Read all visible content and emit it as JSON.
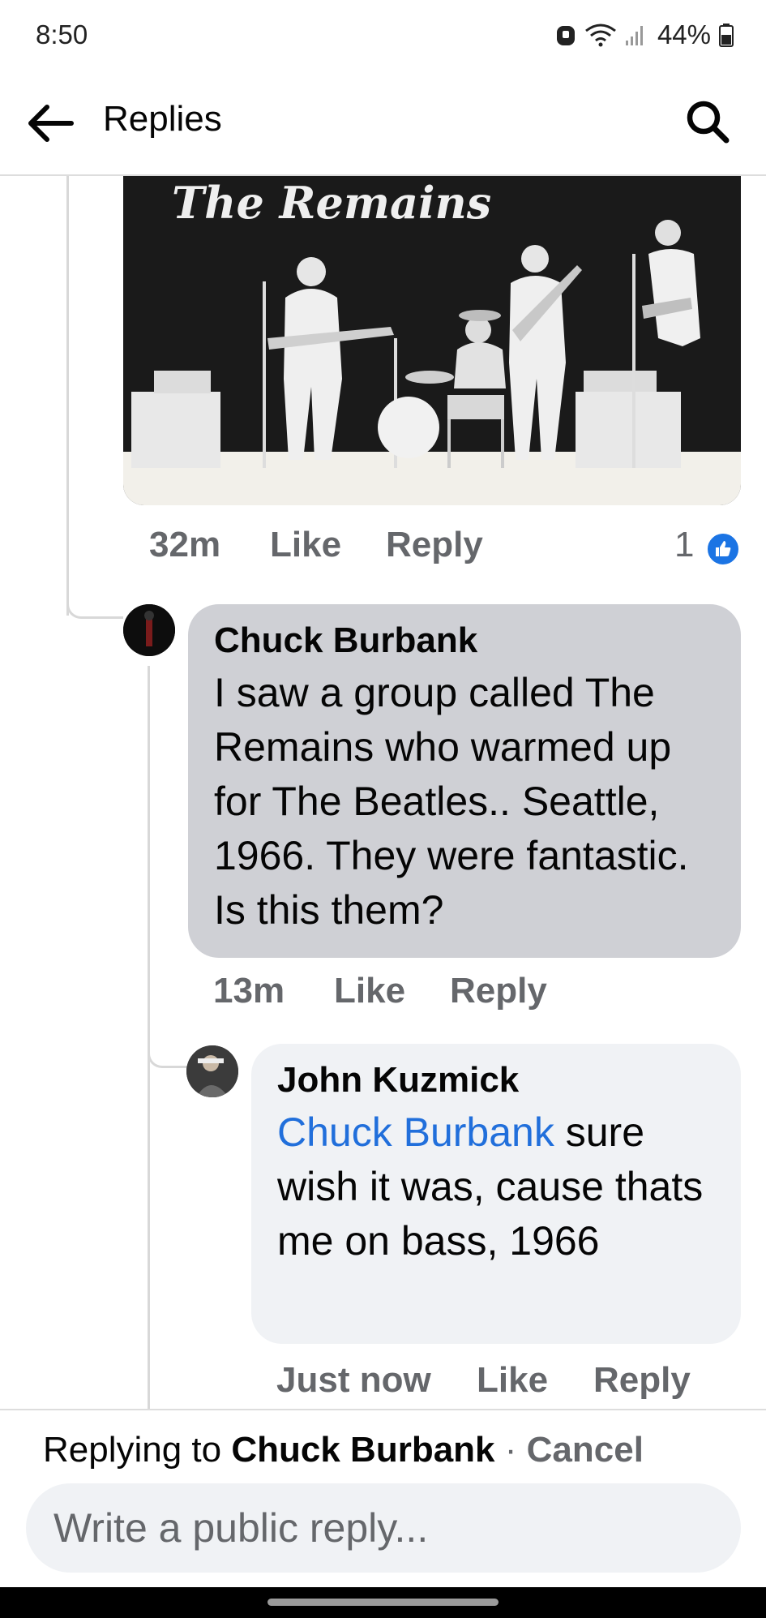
{
  "status_bar": {
    "time": "8:50",
    "battery": "44%",
    "icons": [
      "alarm-icon",
      "wifi-icon",
      "signal-icon",
      "battery-icon"
    ]
  },
  "header": {
    "title": "Replies",
    "back_icon": "arrow-left-icon",
    "search_icon": "search-icon"
  },
  "photo": {
    "caption_text": "The Remains"
  },
  "parent_meta": {
    "time": "32m",
    "like": "Like",
    "reply": "Reply",
    "reaction_count": "1"
  },
  "comments": [
    {
      "author": "Chuck Burbank",
      "text": "I saw a group called The Remains who warmed up for The Beatles.. Seattle, 1966. They were fantastic. Is this them?",
      "time": "13m",
      "like": "Like",
      "reply": "Reply"
    },
    {
      "author": "John Kuzmick",
      "mention": "Chuck Burbank",
      "text": " sure wish it was, cause thats me on bass, 1966",
      "time": "Just now",
      "like": "Like",
      "reply": "Reply"
    }
  ],
  "reply_bar": {
    "prefix": "Replying to ",
    "name": "Chuck Burbank",
    "separator": " · ",
    "cancel": "Cancel",
    "placeholder": "Write a public reply..."
  },
  "colors": {
    "link": "#216fdb",
    "meta": "#65676b",
    "bubble_selected": "#cfd0d5",
    "bubble": "#f0f2f5",
    "like_blue": "#1b74e4"
  }
}
